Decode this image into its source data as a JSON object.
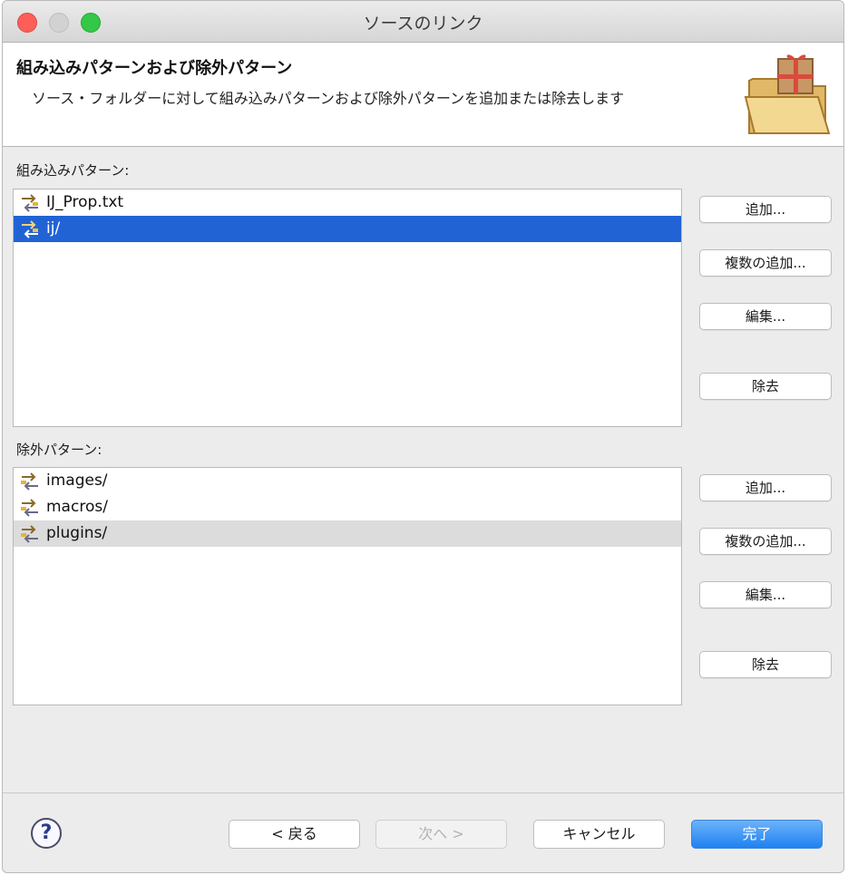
{
  "window": {
    "title": "ソースのリンク"
  },
  "header": {
    "title": "組み込みパターンおよび除外パターン",
    "description": "ソース・フォルダーに対して組み込みパターンおよび除外パターンを追加または除去します"
  },
  "inclusion": {
    "label": "組み込みパターン:",
    "items": [
      {
        "text": "IJ_Prop.txt",
        "icon": "inclusion-pattern-icon"
      },
      {
        "text": "ij/",
        "icon": "inclusion-pattern-icon",
        "selected": true
      }
    ],
    "buttons": {
      "add": "追加...",
      "add_multiple": "複数の追加...",
      "edit": "編集...",
      "remove": "除去"
    }
  },
  "exclusion": {
    "label": "除外パターン:",
    "items": [
      {
        "text": "images/",
        "icon": "exclusion-pattern-icon"
      },
      {
        "text": "macros/",
        "icon": "exclusion-pattern-icon"
      },
      {
        "text": "plugins/",
        "icon": "exclusion-pattern-icon",
        "highlighted": true
      }
    ],
    "buttons": {
      "add": "追加...",
      "add_multiple": "複数の追加...",
      "edit": "編集...",
      "remove": "除去"
    }
  },
  "footer": {
    "help": "?",
    "back": "< 戻る",
    "next": "次へ >",
    "cancel": "キャンセル",
    "finish": "完了"
  },
  "colors": {
    "selection": "#2163d5",
    "primary_button": "#1f81f1",
    "close": "#fc5f57",
    "maximize": "#34c748"
  }
}
